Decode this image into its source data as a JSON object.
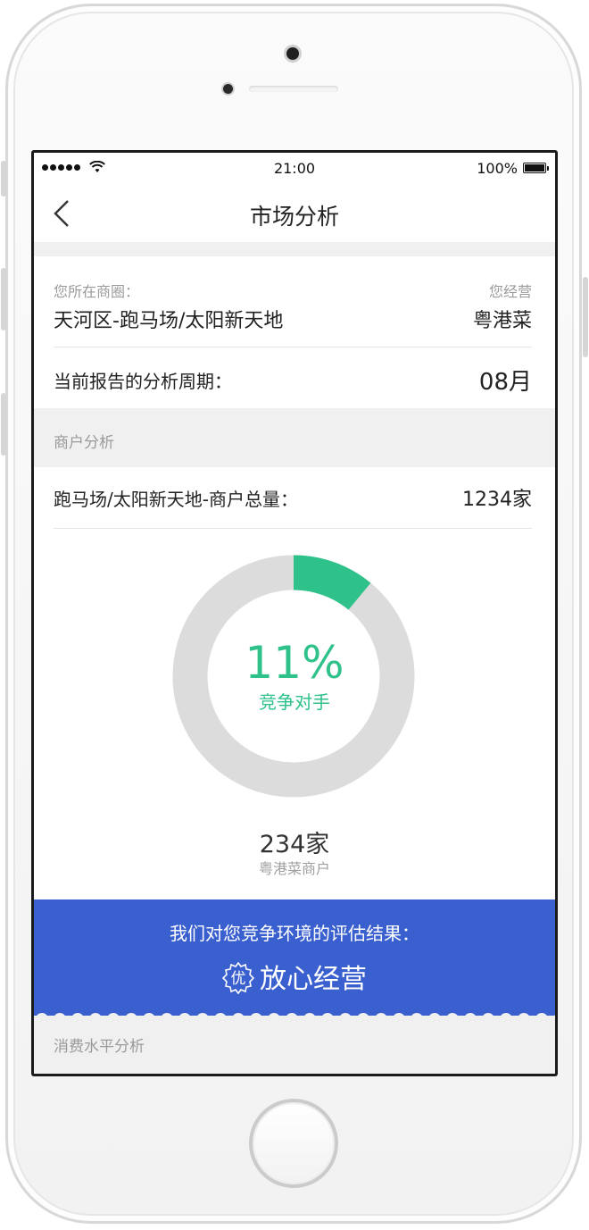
{
  "status_bar": {
    "time": "21:00",
    "battery": "100%"
  },
  "nav": {
    "title": "市场分析"
  },
  "district": {
    "label": "您所在商圈：",
    "value": "天河区-跑马场/太阳新天地",
    "operate_label": "您经营",
    "operate_value": "粤港菜"
  },
  "period": {
    "label": "当前报告的分析周期：",
    "value": "08月"
  },
  "merchant_section": {
    "title": "商户分析"
  },
  "merchant_total": {
    "label": "跑马场/太阳新天地-商户总量：",
    "value": "1234家"
  },
  "donut": {
    "percent_text": "11%",
    "percent": 11,
    "label": "竞争对手",
    "accent_color": "#2ec28a",
    "track_color": "#dcdcdc"
  },
  "competitor": {
    "count": "234家",
    "label": "粤港菜商户"
  },
  "result": {
    "title": "我们对您竞争环境的评估结果：",
    "badge": "优",
    "value": "放心经营",
    "background": "#3a5fcf"
  },
  "footer_section": {
    "title": "消费水平分析"
  }
}
